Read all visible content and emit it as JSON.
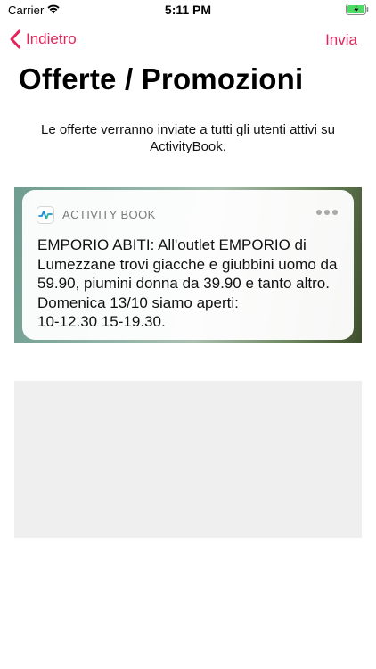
{
  "status_bar": {
    "carrier": "Carrier",
    "time": "5:11 PM",
    "icons": [
      "wifi-icon",
      "battery-charging-icon"
    ]
  },
  "nav": {
    "back_label": "Indietro",
    "send_label": "Invia",
    "accent_color": "#e2245c"
  },
  "page": {
    "title": "Offerte / Promozioni",
    "description": "Le offerte verranno inviate a tutti gli utenti attivi su ActivityBook."
  },
  "notification": {
    "app_name": "ACTIVITY BOOK",
    "app_icon": "activity-pulse-icon",
    "message": "EMPORIO ABITI: All'outlet EMPORIO di Lumezzane trovi giacche e giubbini uomo da 59.90, piumini donna da 39.90 e tanto altro. Domenica 13/10 siamo aperti:\n10-12.30  15-19.30."
  }
}
